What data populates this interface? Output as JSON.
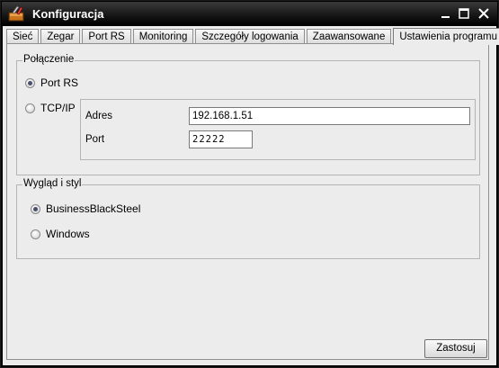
{
  "window": {
    "title": "Konfiguracja"
  },
  "tabs": [
    {
      "label": "Sieć",
      "active": false
    },
    {
      "label": "Zegar",
      "active": false
    },
    {
      "label": "Port RS",
      "active": false
    },
    {
      "label": "Monitoring",
      "active": false
    },
    {
      "label": "Szczegóły logowania",
      "active": false
    },
    {
      "label": "Zaawansowane",
      "active": false
    },
    {
      "label": "Ustawienia programu",
      "active": true
    }
  ],
  "connection": {
    "legend": "Połączenie",
    "options": [
      {
        "label": "Port RS",
        "selected": true
      },
      {
        "label": "TCP/IP",
        "selected": false
      }
    ],
    "address_label": "Adres",
    "address_value": "192.168.1.51",
    "port_label": "Port",
    "port_value": "22222"
  },
  "style": {
    "legend": "Wygląd i styl",
    "options": [
      {
        "label": "BusinessBlackSteel",
        "selected": true
      },
      {
        "label": "Windows",
        "selected": false
      }
    ]
  },
  "buttons": {
    "apply_label": "Zastosuj"
  },
  "colors": {
    "titlebar": "#151515",
    "client_bg": "#ececec",
    "radio_dot": "#4a4f6b"
  }
}
